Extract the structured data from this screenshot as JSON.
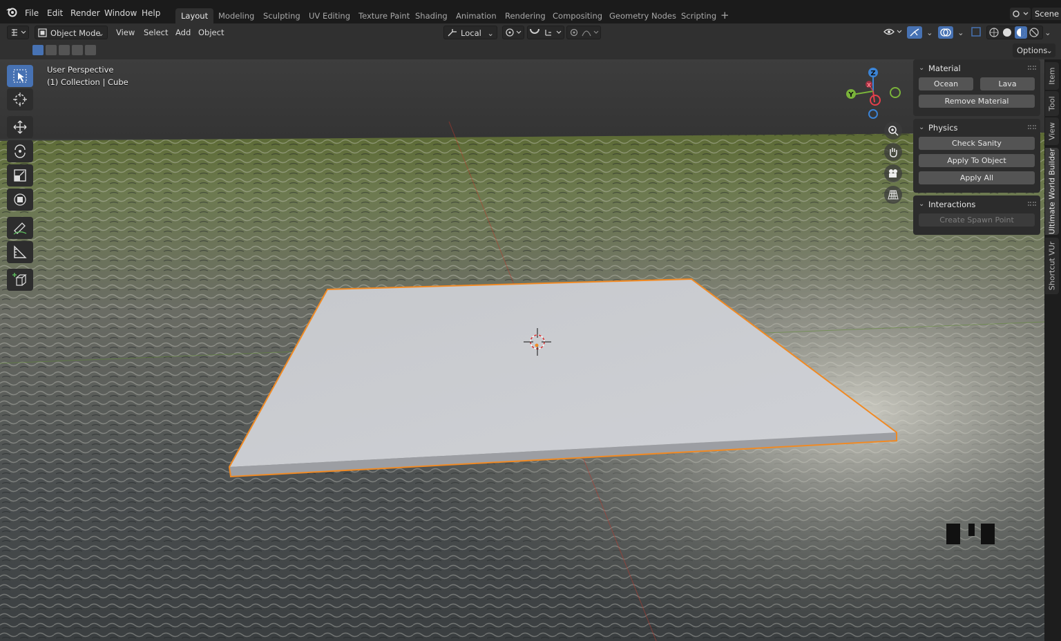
{
  "topbar": {
    "menus": [
      "File",
      "Edit",
      "Render",
      "Window",
      "Help"
    ],
    "workspaces": [
      "Layout",
      "Modeling",
      "Sculpting",
      "UV Editing",
      "Texture Paint",
      "Shading",
      "Animation",
      "Rendering",
      "Compositing",
      "Geometry Nodes",
      "Scripting"
    ],
    "active_workspace": "Layout",
    "scene_name": "Scene"
  },
  "header": {
    "mode": "Object Mode",
    "menus": [
      "View",
      "Select",
      "Add",
      "Object"
    ],
    "transform_orientation": "Local",
    "options_label": "Options"
  },
  "viewport": {
    "perspective_label": "User Perspective",
    "collection_label": "(1) Collection | Cube",
    "gizmo_axes": [
      "Z",
      "X",
      "Y"
    ]
  },
  "npanel": {
    "material": {
      "title": "Material",
      "ocean": "Ocean",
      "lava": "Lava",
      "remove": "Remove Material"
    },
    "physics": {
      "title": "Physics",
      "check": "Check Sanity",
      "apply_object": "Apply To Object",
      "apply_all": "Apply All"
    },
    "interactions": {
      "title": "Interactions",
      "spawn": "Create Spawn Point"
    }
  },
  "sidetabs": [
    "Item",
    "Tool",
    "View",
    "Ultimate World Builder",
    "Shortcut VUr"
  ],
  "colors": {
    "accent": "#4772b3",
    "selection_outline": "#f08a24",
    "axis_x": "#e6404b",
    "axis_y": "#7ab33a",
    "axis_z": "#3b84d6"
  }
}
